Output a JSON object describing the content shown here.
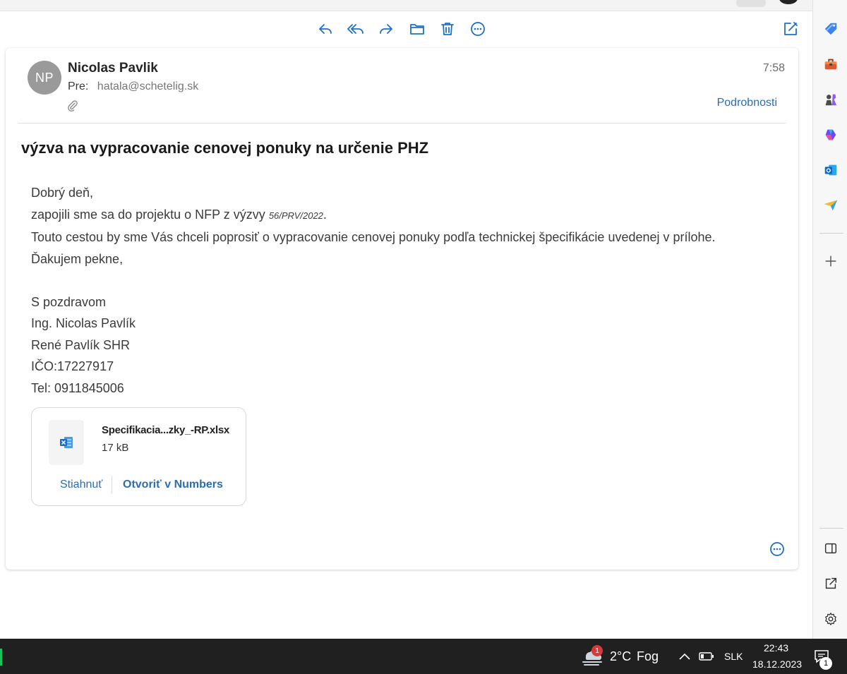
{
  "toolbar": {
    "icons": [
      "reply-icon",
      "reply-all-icon",
      "forward-icon",
      "move-folder-icon",
      "trash-icon",
      "more-icon",
      "compose-icon"
    ],
    "accent_color": "#1f6fc5"
  },
  "message": {
    "avatar_initials": "NP",
    "sender_name": "Nicolas Pavlik",
    "to_label": "Pre:",
    "to_email": "hatala@schetelig.sk",
    "time": "7:58",
    "details_label": "Podrobnosti",
    "subject": "výzva na vypracovanie cenovej ponuky na určenie PHZ",
    "body": {
      "greeting": "Dobrý deň,",
      "line2_text": "zapojili sme sa do projektu o NFP z výzvy",
      "line2_ref": "56/PRV/2022",
      "line2_end": ".",
      "line3": "Touto cestou by sme Vás chceli poprosiť o vypracovanie cenovej ponuky podľa technickej špecifikácie uvedenej v prílohe.",
      "line4": "Ďakujem pekne,",
      "sign_off": "S pozdravom",
      "sig_name": "Ing. Nicolas Pavlík",
      "sig_company": "René Pavlík SHR",
      "sig_ico": "IČO:17227917",
      "sig_tel": "Tel: 0911845006"
    },
    "attachment": {
      "file_name": "Specifikacia...zky_-RP.xlsx",
      "file_size": "17 kB",
      "download_label": "Stiahnuť",
      "open_label": "Otvoriť v Numbers"
    }
  },
  "sidebar": {
    "icons": [
      "tag-icon",
      "toolbox-icon",
      "chess-icon",
      "copilot-icon",
      "outlook-icon",
      "send-icon",
      "add-icon",
      "split-view-icon",
      "open-external-icon",
      "settings-icon"
    ]
  },
  "taskbar": {
    "weather_badge": "1",
    "temperature": "2°C",
    "condition": "Fog",
    "language": "SLK",
    "time": "22:43",
    "date": "18.12.2023",
    "notification_count": "1"
  }
}
